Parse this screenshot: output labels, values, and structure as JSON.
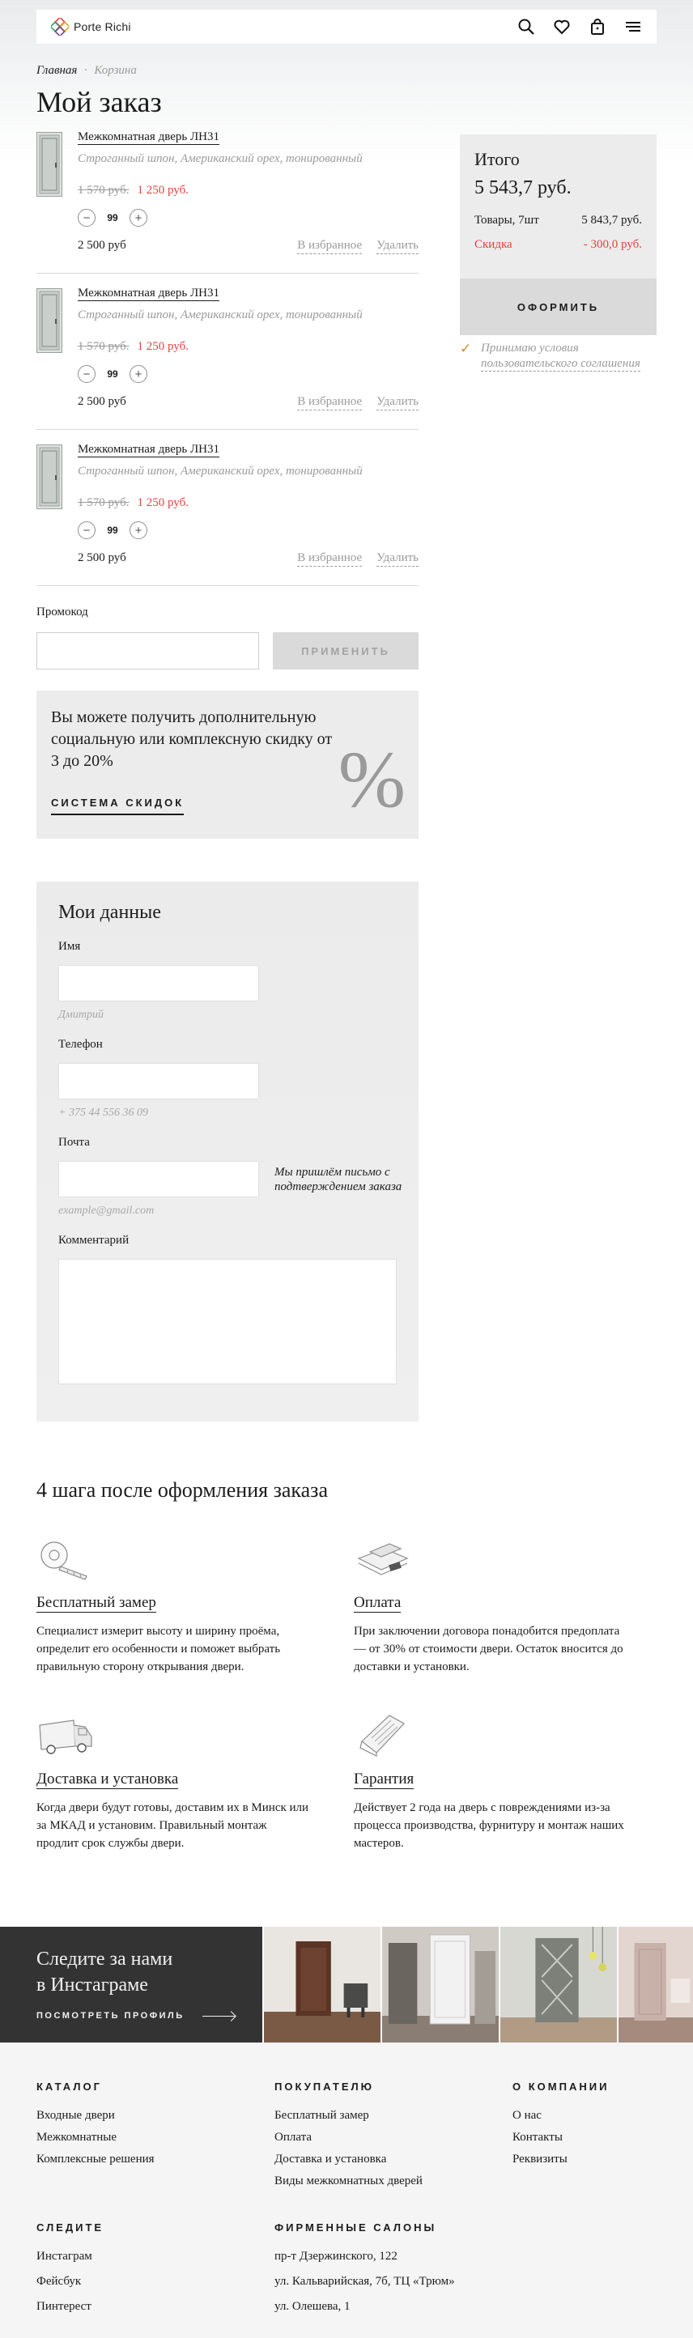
{
  "header": {
    "logo_text": "Porte Richi",
    "icons": [
      "search-icon",
      "heart-icon",
      "bag-icon",
      "menu-icon"
    ]
  },
  "breadcrumb": {
    "home": "Главная",
    "current": "Корзина",
    "separator": "·"
  },
  "page_title": "Мой заказ",
  "cart_items": [
    {
      "name": "Межкомнатная дверь ЛН31",
      "description": "Строганный шпон, Американский орех, тонированный",
      "old_price": "1 570 руб.",
      "new_price": "1 250 руб.",
      "quantity": "99",
      "minus": "−",
      "plus": "+",
      "total": "2 500 руб",
      "favorite_label": "В избранное",
      "delete_label": "Удалить"
    },
    {
      "name": "Межкомнатная дверь ЛН31",
      "description": "Строганный шпон, Американский орех, тонированный",
      "old_price": "1 570 руб.",
      "new_price": "1 250 руб.",
      "quantity": "99",
      "minus": "−",
      "plus": "+",
      "total": "2 500 руб",
      "favorite_label": "В избранное",
      "delete_label": "Удалить"
    },
    {
      "name": "Межкомнатная дверь ЛН31",
      "description": "Строганный шпон, Американский орех, тонированный",
      "old_price": "1 570 руб.",
      "new_price": "1 250 руб.",
      "quantity": "99",
      "minus": "−",
      "plus": "+",
      "total": "2 500 руб",
      "favorite_label": "В избранное",
      "delete_label": "Удалить"
    }
  ],
  "summary": {
    "title": "Итого",
    "total": "5 543,7 руб.",
    "goods_label": "Товары, 7шт",
    "goods_value": "5 843,7 руб.",
    "discount_label": "Скидка",
    "discount_value": "- 300,0 руб.",
    "order_button": "ОФОРМИТЬ",
    "agree_prefix": "Принимаю условия",
    "agree_link": "пользовательского соглашения"
  },
  "promo": {
    "label": "Промокод",
    "placeholder": "",
    "apply_button": "ПРИМЕНИТЬ"
  },
  "discount_block": {
    "text": "Вы можете получить дополнительную социальную или комплексную скидку от 3 до 20%",
    "link": "СИСТЕМА СКИДОК",
    "symbol": "%"
  },
  "my_data": {
    "title": "Мои данные",
    "name_label": "Имя",
    "name_placeholder": "Дмитрий",
    "phone_label": "Телефон",
    "phone_placeholder": "+ 375 44 556 36 09",
    "email_label": "Почта",
    "email_placeholder": "example@gmail.com",
    "email_note": "Мы пришлём письмо с подтверждением заказа",
    "comment_label": "Комментарий"
  },
  "steps": {
    "title": "4 шага после оформления заказа",
    "items": [
      {
        "icon": "tape-measure-icon",
        "name": "Бесплатный замер",
        "text": "Специалист измерит высоту и ширину проёма, определит его особенности и поможет выбрать правильную сторону открывания двери."
      },
      {
        "icon": "payment-icon",
        "name": "Оплата",
        "text": "При заключении договора  понадобится предоплата — от 30% от стоимости двери. Остаток вносится до доставки и установки."
      },
      {
        "icon": "delivery-van-icon",
        "name": "Доставка и установка",
        "text": "Когда двери будут готовы, доставим их в Минск или за МКАД и установим. Правильный монтаж продлит срок службы двери."
      },
      {
        "icon": "warranty-icon",
        "name": "Гарантия",
        "text": "Действует 2 года на дверь с повреждениями из-за процесса производства, фурнитуру и монтаж наших мастеров."
      }
    ]
  },
  "instagram": {
    "title_line1": "Следите за нами",
    "title_line2": "в Инстаграме",
    "link": "ПОСМОТРЕТЬ ПРОФИЛЬ"
  },
  "footer": {
    "catalog": {
      "title": "КАТАЛОГ",
      "links": [
        "Входные двери",
        "Межкомнатные",
        "Комплексные решения"
      ]
    },
    "buyer": {
      "title": "ПОКУПАТЕЛЮ",
      "links": [
        "Бесплатный замер",
        "Оплата",
        "Доставка и установка",
        "Виды межкомнатных дверей"
      ]
    },
    "company": {
      "title": "О КОМПАНИИ",
      "links": [
        "О нас",
        "Контакты",
        "Реквизиты"
      ]
    },
    "follow": {
      "title": "СЛЕДИТЕ",
      "links": [
        "Инстаграм",
        "Фейсбук",
        "Пинтерест"
      ]
    },
    "salons": {
      "title": "ФИРМЕННЫЕ САЛОНЫ",
      "links": [
        "пр-т Дзержинского, 122",
        "ул. Кальварийская, 7б, ТЦ «Трюм»",
        "ул. Олешева, 1"
      ]
    }
  },
  "colors": {
    "accent_red": "#e0443e",
    "check_orange": "#d98b2b",
    "panel_grey": "#ececec",
    "dark": "#333333"
  }
}
